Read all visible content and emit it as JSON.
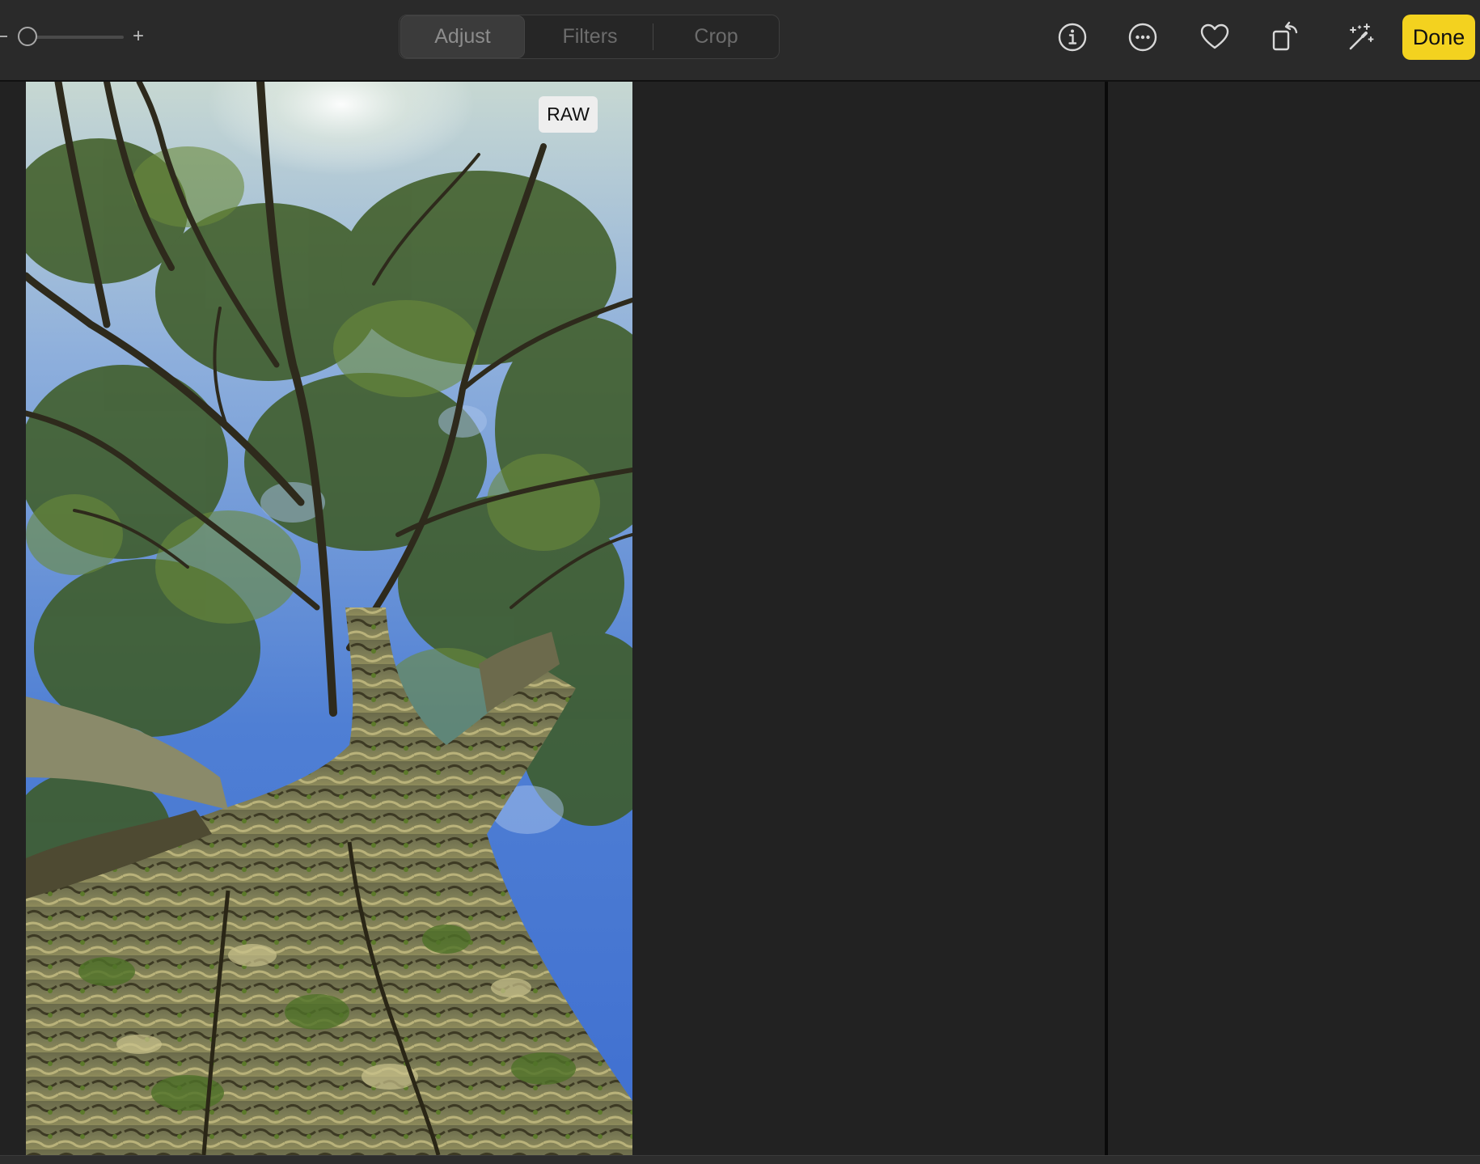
{
  "toolbar": {
    "zoom_plus": "+",
    "tabs": [
      {
        "label": "Adjust",
        "active": true
      },
      {
        "label": "Filters",
        "active": false
      },
      {
        "label": "Crop",
        "active": false
      }
    ],
    "icons": [
      "info-icon",
      "more-icon",
      "heart-icon",
      "rotate-icon",
      "magic-wand-icon"
    ],
    "done_label": "Done",
    "accent_color": "#f3d21f"
  },
  "photo": {
    "badge": "RAW"
  }
}
